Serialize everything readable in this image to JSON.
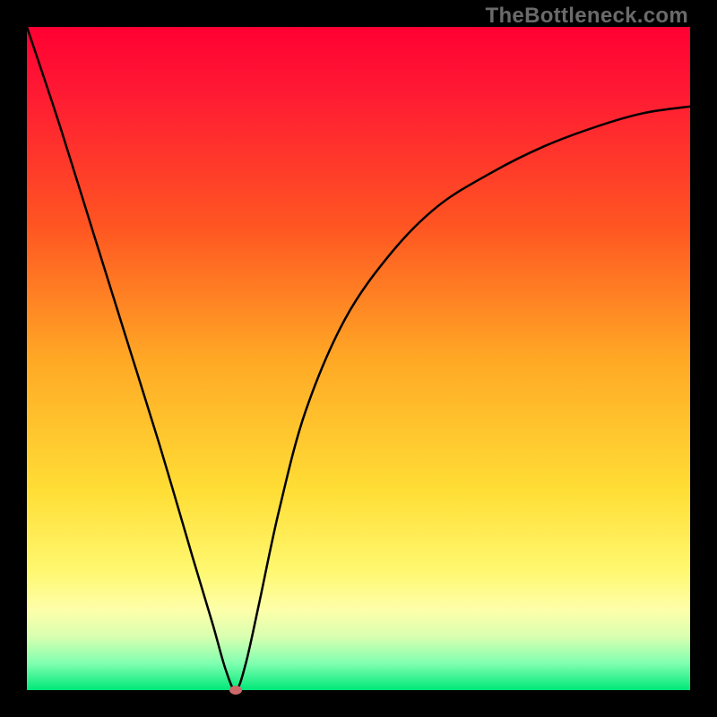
{
  "watermark": "TheBottleneck.com",
  "chart_data": {
    "type": "line",
    "title": "",
    "xlabel": "",
    "ylabel": "",
    "xlim": [
      0,
      100
    ],
    "ylim": [
      0,
      100
    ],
    "grid": false,
    "series": [
      {
        "name": "bottleneck-curve",
        "x": [
          0,
          5,
          10,
          15,
          20,
          25,
          28,
          30,
          31.5,
          33,
          35,
          38,
          42,
          48,
          55,
          62,
          70,
          78,
          86,
          93,
          100
        ],
        "y": [
          100,
          85,
          69,
          53,
          37,
          20,
          10,
          3,
          0,
          4,
          13,
          27,
          42,
          56,
          66,
          73,
          78,
          82,
          85,
          87,
          88
        ]
      }
    ],
    "marker": {
      "x": 31.5,
      "y": 0,
      "color": "#cc6a6a"
    },
    "background_gradient": [
      "#ff0033",
      "#ff5522",
      "#ffa825",
      "#ffde35",
      "#fff870",
      "#d8ffb0",
      "#00e878"
    ]
  }
}
